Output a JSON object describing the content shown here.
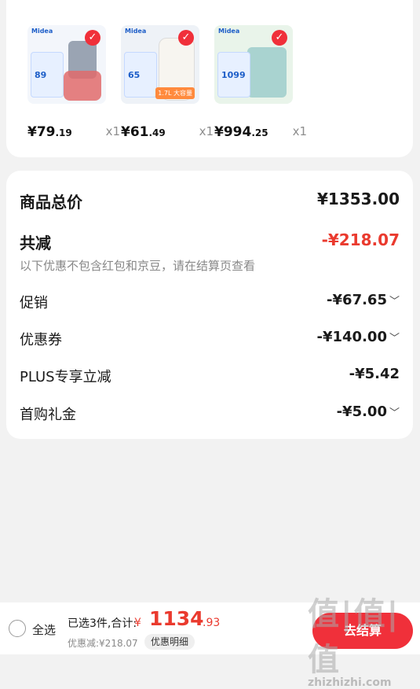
{
  "products": [
    {
      "name": "food-chopper",
      "price_int": "¥79",
      "price_dec": ".19",
      "qty": "x1",
      "thumb_bg": "#f3f6fb",
      "brand": "Midea",
      "promo_num": "89",
      "badge": ""
    },
    {
      "name": "electric-kettle",
      "price_int": "¥61",
      "price_dec": ".49",
      "qty": "x1",
      "thumb_bg": "#eef2f7",
      "brand": "Midea",
      "promo_num": "65",
      "badge": "1.7L 大容量"
    },
    {
      "name": "mini-fridge",
      "price_int": "¥994",
      "price_dec": ".25",
      "qty": "x1",
      "thumb_bg": "#e9f4ea",
      "brand": "Midea",
      "promo_num": "1099",
      "badge": ""
    }
  ],
  "summary": {
    "total_label": "商品总价",
    "total_value": "¥1353.00",
    "reduce_label": "共减",
    "reduce_value": "-¥218.07",
    "note": "以下优惠不包含红包和京豆，请在结算页查看",
    "items": [
      {
        "label": "促销",
        "value": "-¥67.65",
        "has_chevron": true
      },
      {
        "label": "优惠券",
        "value": "-¥140.00",
        "has_chevron": true
      },
      {
        "label": "PLUS专享立减",
        "value": "-¥5.42",
        "has_chevron": false
      },
      {
        "label": "首购礼金",
        "value": "-¥5.00",
        "has_chevron": true
      }
    ]
  },
  "bottom_bar": {
    "select_all": "全选",
    "selected_count": "已选3件,合计:",
    "currency": "¥",
    "total_int": "1134",
    "total_dec": ".93",
    "discount": "优惠减:¥218.07",
    "detail_label": "优惠明细",
    "checkout_label": "去结算"
  },
  "watermark": {
    "big": "值|值|值",
    "small": "zhizhizhi.com"
  },
  "colors": {
    "accent_red": "#ea3a2e",
    "check_red": "#f0303a",
    "background": "#f2f2f2"
  },
  "icons": {
    "check": "check-icon",
    "chevron": "chevron-down-icon",
    "radio": "radio-unchecked-icon"
  }
}
